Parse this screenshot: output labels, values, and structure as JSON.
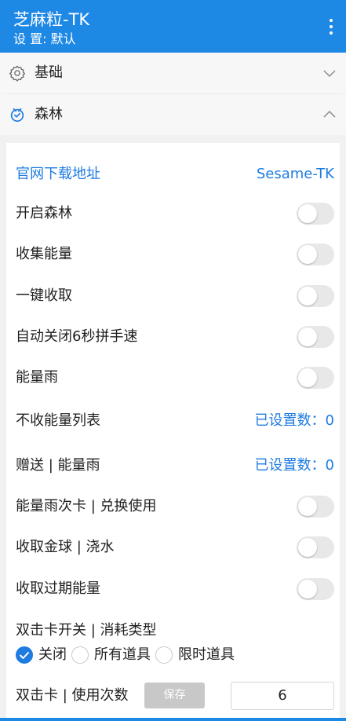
{
  "app": {
    "title": "芝麻粒-TK",
    "subtitle": "设 置: 默认"
  },
  "sections": {
    "basic": {
      "label": "基础",
      "expanded": false
    },
    "forest": {
      "label": "森林",
      "expanded": true
    }
  },
  "panel": {
    "download": {
      "label": "官网下载地址",
      "link": "Sesame-TK"
    },
    "toggles": [
      {
        "label": "开启森林",
        "on": false
      },
      {
        "label": "收集能量",
        "on": false
      },
      {
        "label": "一键收取",
        "on": false
      },
      {
        "label": "自动关闭6秒拼手速",
        "on": false
      },
      {
        "label": "能量雨",
        "on": false
      }
    ],
    "lists": [
      {
        "label": "不收能量列表",
        "value": "已设置数：0"
      },
      {
        "label": "赠送 | 能量雨",
        "value": "已设置数：0"
      }
    ],
    "toggles2": [
      {
        "label": "能量雨次卡 | 兑换使用",
        "on": false
      },
      {
        "label": "收取金球 | 浇水",
        "on": false
      },
      {
        "label": "收取过期能量",
        "on": false
      }
    ],
    "double_card": {
      "label": "双击卡开关 | 消耗类型",
      "options": [
        "关闭",
        "所有道具",
        "限时道具"
      ],
      "selected": "关闭"
    },
    "double_count": {
      "label": "双击卡 | 使用次数",
      "save_label": "保存",
      "value": "6"
    }
  },
  "colors": {
    "primary": "#1e88e5",
    "link": "#1e7be0",
    "toggle_off": "#e8e8e8"
  }
}
